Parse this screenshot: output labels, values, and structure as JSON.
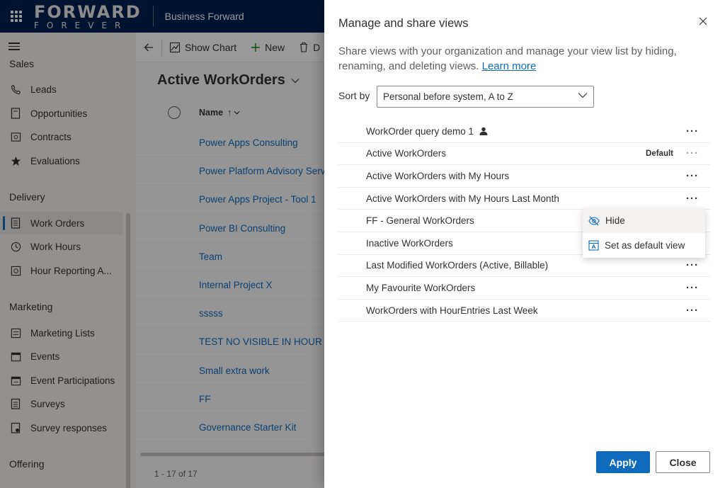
{
  "header": {
    "logo_main": "FORWARD",
    "logo_sub": "FOREVER",
    "app_name": "Business Forward"
  },
  "sidebar": {
    "sections": [
      {
        "label": "Sales"
      },
      {
        "label": "Delivery"
      },
      {
        "label": "Marketing"
      },
      {
        "label": "Offering"
      }
    ],
    "items": [
      {
        "label": "Leads",
        "icon": "phone-icon"
      },
      {
        "label": "Opportunities",
        "icon": "document-icon"
      },
      {
        "label": "Contracts",
        "icon": "contract-icon"
      },
      {
        "label": "Evaluations",
        "icon": "star-icon"
      },
      {
        "label": "Work Orders",
        "icon": "list-icon",
        "active": true
      },
      {
        "label": "Work Hours",
        "icon": "clock-icon"
      },
      {
        "label": "Hour Reporting A...",
        "icon": "report-icon"
      },
      {
        "label": "Marketing Lists",
        "icon": "list-icon"
      },
      {
        "label": "Events",
        "icon": "calendar-icon"
      },
      {
        "label": "Event Participations",
        "icon": "calendar-icon"
      },
      {
        "label": "Surveys",
        "icon": "survey-icon"
      },
      {
        "label": "Survey responses",
        "icon": "survey-icon"
      }
    ]
  },
  "commandbar": {
    "show_chart": "Show Chart",
    "new": "New",
    "delete_partial": "D"
  },
  "main": {
    "view_title": "Active WorkOrders",
    "column_name": "Name",
    "rows": [
      "Power Apps Consulting",
      "Power Platform Advisory Servi",
      "Power Apps Project - Tool 1",
      "Power BI Consulting",
      "Team",
      "Internal Project X",
      "sssss",
      "TEST NO VISIBLE IN HOUR EN",
      "Small extra work",
      "FF",
      "Governance Starter Kit"
    ],
    "record_count": "1 - 17 of 17"
  },
  "panel": {
    "title": "Manage and share views",
    "description": "Share views with your organization and manage your view list by hiding, renaming, and deleting views.",
    "learn_more": "Learn more",
    "sort_label": "Sort by",
    "sort_value": "Personal before system, A to Z",
    "views": [
      {
        "name": "WorkOrder query demo 1",
        "personal": true
      },
      {
        "name": "Active WorkOrders",
        "default": "Default"
      },
      {
        "name": "Active WorkOrders with My Hours"
      },
      {
        "name": "Active WorkOrders with My Hours Last Month"
      },
      {
        "name": "FF - General WorkOrders"
      },
      {
        "name": "Inactive WorkOrders"
      },
      {
        "name": "Last Modified WorkOrders (Active, Billable)"
      },
      {
        "name": "My Favourite WorkOrders"
      },
      {
        "name": "WorkOrders with HourEntries Last Week"
      }
    ],
    "menu": {
      "hide": "Hide",
      "set_default": "Set as default view"
    },
    "apply": "Apply",
    "close": "Close"
  },
  "colors": {
    "topbar": "#002050",
    "accent": "#0f6cbd"
  }
}
